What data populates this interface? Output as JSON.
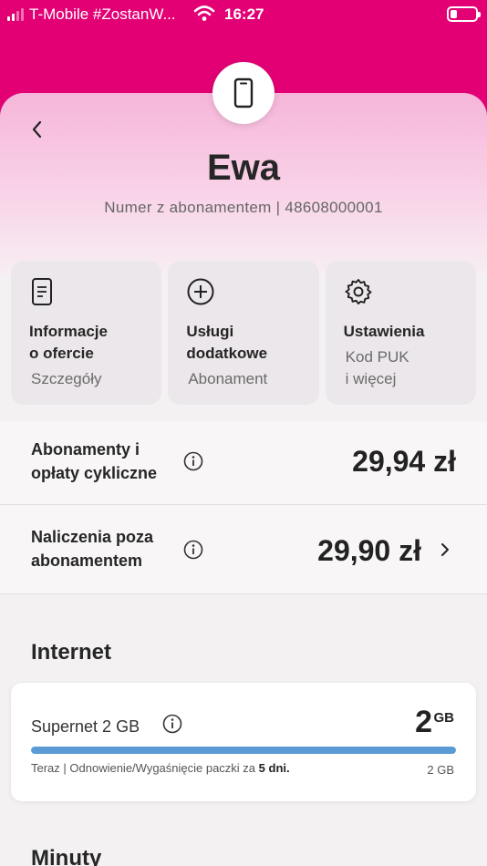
{
  "status_bar": {
    "carrier": "T-Mobile #ZostanW...",
    "time": "16:27"
  },
  "colors": {
    "brand": "#e20074",
    "progress": "#5b9bd5"
  },
  "header": {
    "icon": "phone-icon",
    "back_icon": "chevron-left-icon",
    "name": "Ewa",
    "subtitle": "Numer z abonamentem | 48608000001"
  },
  "tiles": [
    {
      "icon": "document-icon",
      "title": "Informacje\no ofercie",
      "subtitle": "Szczegóły"
    },
    {
      "icon": "plus-circle-icon",
      "title": "Usługi\ndodatkowe",
      "subtitle": "Abonament"
    },
    {
      "icon": "gear-icon",
      "title": "Ustawienia",
      "subtitle": "Kod PUK\ni więcej"
    }
  ],
  "charges": [
    {
      "label": "Abonamenty i\nopłaty cykliczne",
      "amount": "29,94 zł"
    },
    {
      "label": "Naliczenia poza\nabonamentem",
      "amount": "29,90 zł"
    }
  ],
  "internet": {
    "section_title": "Internet",
    "package_name": "Supernet 2 GB",
    "remaining_value": "2",
    "remaining_unit": "GB",
    "progress_fraction": 1.0,
    "renewal_prefix": "Teraz | Odnowienie/Wygaśnięcie paczki za ",
    "renewal_days": "5 dni.",
    "capacity": "2 GB"
  },
  "next_section_title": "Minuty"
}
